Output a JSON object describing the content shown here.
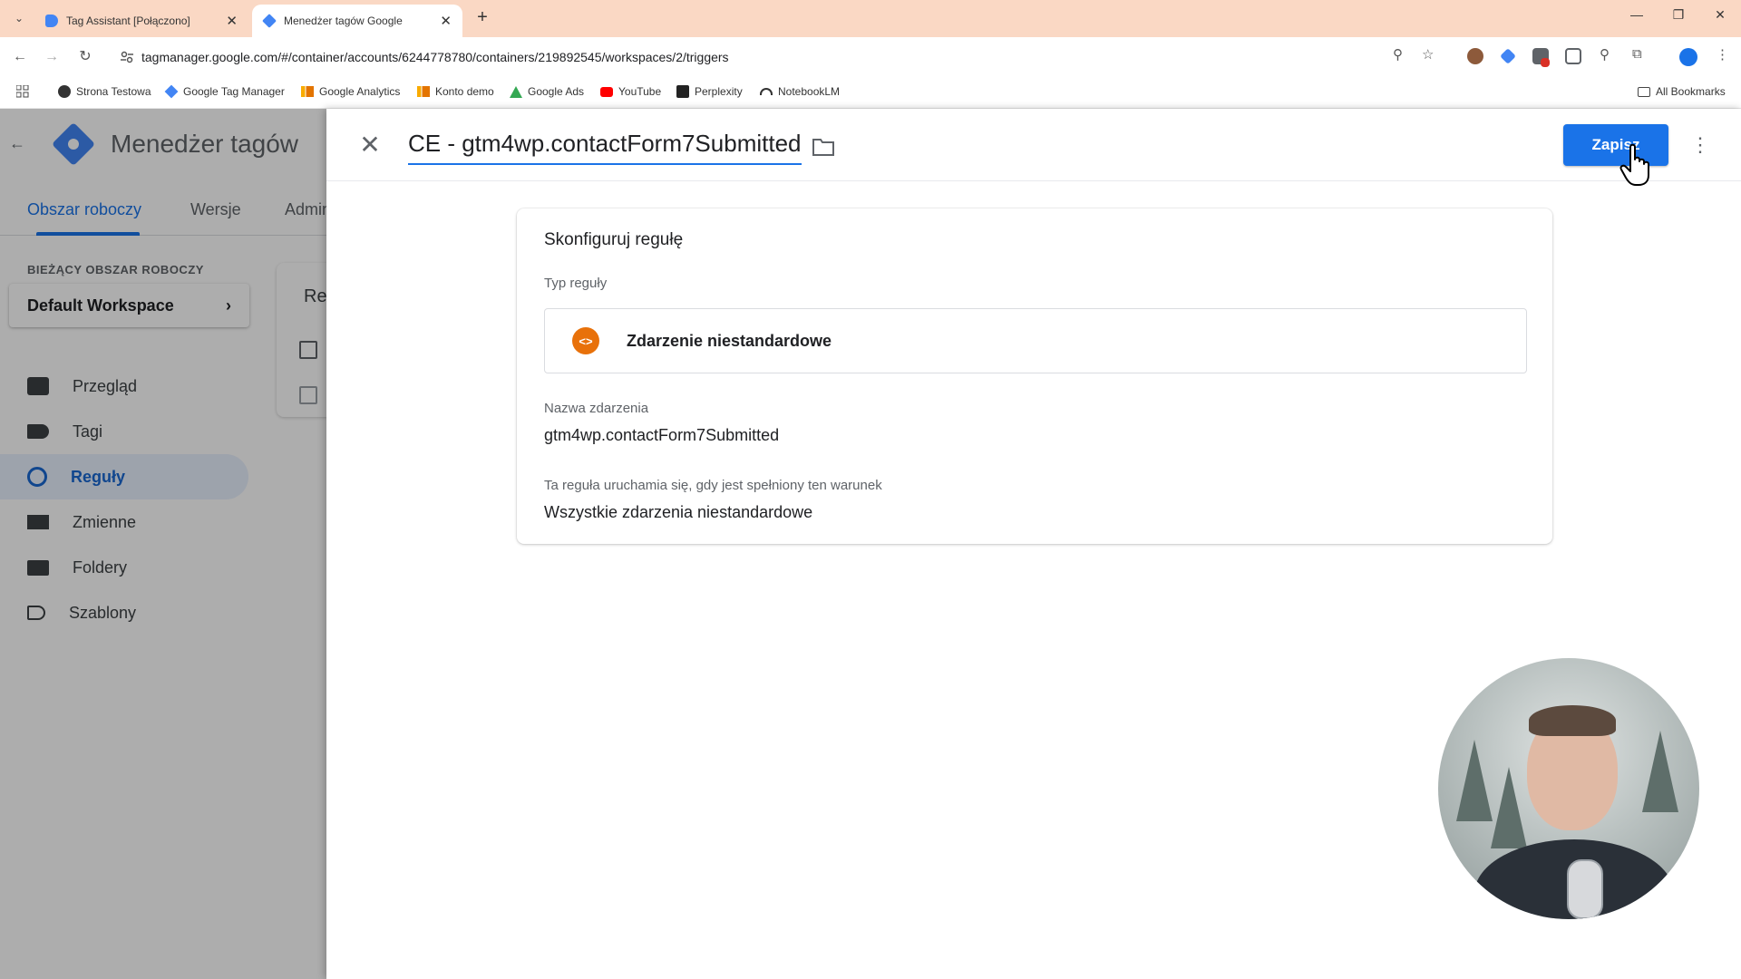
{
  "browser": {
    "tabs": [
      {
        "label": "Tag Assistant [Połączono]",
        "active": false
      },
      {
        "label": "Menedżer tagów Google",
        "active": true
      }
    ],
    "url": "tagmanager.google.com/#/container/accounts/6244778780/containers/219892545/workspaces/2/triggers",
    "bookmarks": [
      {
        "label": "Strona Testowa",
        "icon": "globe-icon"
      },
      {
        "label": "Google Tag Manager",
        "icon": "gtm-icon"
      },
      {
        "label": "Google Analytics",
        "icon": "analytics-icon"
      },
      {
        "label": "Konto demo",
        "icon": "analytics-icon"
      },
      {
        "label": "Google Ads",
        "icon": "ads-icon"
      },
      {
        "label": "YouTube",
        "icon": "youtube-icon"
      },
      {
        "label": "Perplexity",
        "icon": "perplexity-icon"
      },
      {
        "label": "NotebookLM",
        "icon": "notebooklm-icon"
      }
    ],
    "all_bookmarks": "All Bookmarks"
  },
  "gtm": {
    "title": "Menedżer tagów",
    "tabs": [
      "Obszar roboczy",
      "Wersje",
      "Admin"
    ],
    "workspace_label": "BIEŻĄCY OBSZAR ROBOCZY",
    "workspace_name": "Default Workspace",
    "sidebar": [
      {
        "label": "Przegląd",
        "icon": "briefcase-icon",
        "active": false
      },
      {
        "label": "Tagi",
        "icon": "tag-icon",
        "active": false
      },
      {
        "label": "Reguły",
        "icon": "trigger-icon",
        "active": true
      },
      {
        "label": "Zmienne",
        "icon": "variables-icon",
        "active": false
      },
      {
        "label": "Foldery",
        "icon": "folder-icon",
        "active": false
      },
      {
        "label": "Szablony",
        "icon": "template-icon",
        "active": false
      }
    ],
    "bg_card_title": "Re"
  },
  "editor": {
    "trigger_name": "CE - gtm4wp.contactForm7Submitted",
    "save_label": "Zapisz",
    "config_title": "Skonfiguruj regułę",
    "type_label": "Typ reguły",
    "type_name": "Zdarzenie niestandardowe",
    "type_icon_text": "<>",
    "event_name_label": "Nazwa zdarzenia",
    "event_name_value": "gtm4wp.contactForm7Submitted",
    "condition_label": "Ta reguła uruchamia się, gdy jest spełniony ten warunek",
    "condition_value": "Wszystkie zdarzenia niestandardowe"
  },
  "colors": {
    "accent": "#1a73e8",
    "tabbar": "#fad8c4",
    "type_icon": "#e8710a"
  }
}
